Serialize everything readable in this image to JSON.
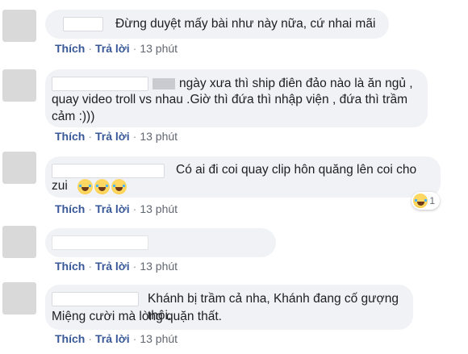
{
  "action_labels": {
    "like": "Thích",
    "reply": "Trả lời",
    "separator": "·"
  },
  "comments": [
    {
      "text": "Đừng duyệt mấy bài như này nữa, cứ nhai mãi",
      "time": "13 phút"
    },
    {
      "text_line1": "ngày xưa thì ship điên đảo nào là ăn ngủ ,",
      "text_line2": "quay video troll vs nhau .Giờ thì đứa thì nhập viện , đứa thì trầm",
      "text_line3": "cảm :)))",
      "time": "13 phút"
    },
    {
      "text_line1": "Có ai đi coi quay clip hôn quăng lên coi cho",
      "text_line2": "zui",
      "emoji": "laughing-crying-emoji",
      "reaction_count": "1",
      "time": "13 phút"
    },
    {
      "text": "",
      "time": "13 phút"
    },
    {
      "text_line1": "Khánh bị trầm cả nha, Khánh đang cố gượng thôi.",
      "text_line2": "Miệng cười mà lòng quặn thất.",
      "time": "13 phút"
    }
  ]
}
